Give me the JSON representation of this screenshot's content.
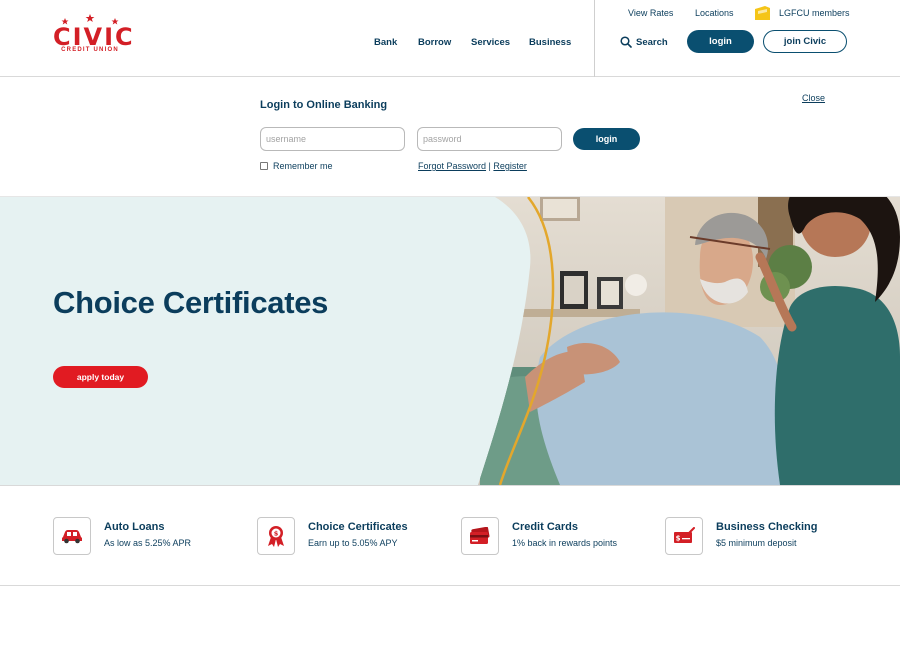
{
  "header": {
    "logo": {
      "word": "CIVIC",
      "tagline": "CREDIT UNION"
    },
    "nav": [
      "Bank",
      "Borrow",
      "Services",
      "Business"
    ],
    "utility": {
      "view_rates": "View Rates",
      "locations": "Locations",
      "members": "LGFCU members"
    },
    "search_label": "Search",
    "login_label": "login",
    "join_label": "join Civic"
  },
  "login_panel": {
    "title": "Login to Online Banking",
    "close": "Close",
    "username_placeholder": "username",
    "password_placeholder": "password",
    "submit": "login",
    "remember": "Remember me",
    "forgot": "Forgot Password",
    "separator": "|",
    "register": "Register"
  },
  "hero": {
    "title": "Choice Certificates",
    "cta": "apply today"
  },
  "features": [
    {
      "title": "Auto Loans",
      "subtitle": "As low as 5.25% APR",
      "icon": "car-icon"
    },
    {
      "title": "Choice Certificates",
      "subtitle": "Earn up to 5.05% APY",
      "icon": "award-ribbon-icon"
    },
    {
      "title": "Credit Cards",
      "subtitle": "1% back in rewards points",
      "icon": "credit-card-icon"
    },
    {
      "title": "Business Checking",
      "subtitle": "$5 minimum deposit",
      "icon": "check-icon"
    }
  ],
  "colors": {
    "navy": "#0b3d5c",
    "button_blue": "#0a4f70",
    "brand_red": "#d31f26",
    "hero_bg": "#e6f2f2",
    "cta_red": "#e11b22",
    "lgfcu_gold": "#f5c518"
  }
}
